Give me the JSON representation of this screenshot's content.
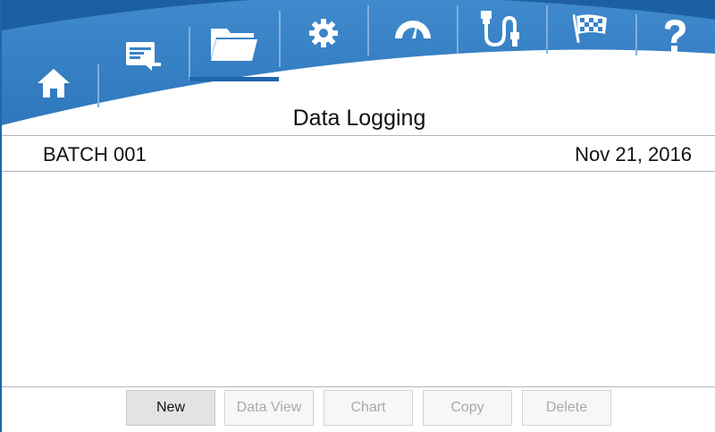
{
  "page": {
    "title": "Data Logging"
  },
  "nav": {
    "items": [
      {
        "id": "home",
        "icon": "home-icon",
        "active": false
      },
      {
        "id": "display",
        "icon": "display-import-icon",
        "active": false
      },
      {
        "id": "data-logging",
        "icon": "folder-icon",
        "active": true
      },
      {
        "id": "settings",
        "icon": "gear-icon",
        "active": false
      },
      {
        "id": "calibration",
        "icon": "gauge-icon",
        "active": false
      },
      {
        "id": "connection",
        "icon": "usb-cable-icon",
        "active": false
      },
      {
        "id": "start",
        "icon": "checkered-flag-icon",
        "active": false
      },
      {
        "id": "help",
        "icon": "question-mark-icon",
        "active": false
      }
    ]
  },
  "list": {
    "rows": [
      {
        "name": "BATCH 001",
        "date": "Nov 21, 2016"
      }
    ]
  },
  "toolbar": {
    "new_label": "New",
    "data_view_label": "Data View",
    "chart_label": "Chart",
    "copy_label": "Copy",
    "delete_label": "Delete"
  },
  "colors": {
    "nav_blue": "#3a83c7",
    "nav_dark_edge": "#1f66ad",
    "icon_white": "#ffffff",
    "active_underline": "#1f66ad",
    "text": "#111111",
    "disabled_text": "#a9a9a9"
  }
}
